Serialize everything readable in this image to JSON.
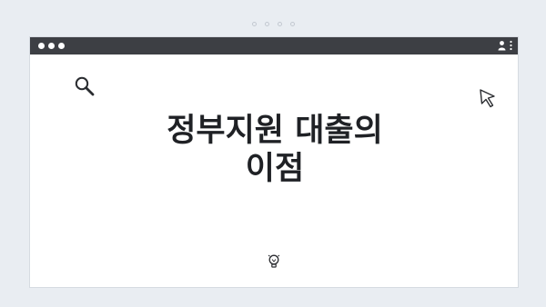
{
  "page": {
    "title_line1": "정부지원 대출의",
    "title_line2": "이점"
  },
  "icons": {
    "search": "search-icon",
    "cursor": "cursor-icon",
    "user": "user-icon",
    "menu": "kebab-menu-icon",
    "bulb": "lightbulb-icon"
  },
  "colors": {
    "background": "#e9edf2",
    "titlebar": "#3d3f44",
    "window": "#ffffff",
    "text": "#1f2125"
  }
}
